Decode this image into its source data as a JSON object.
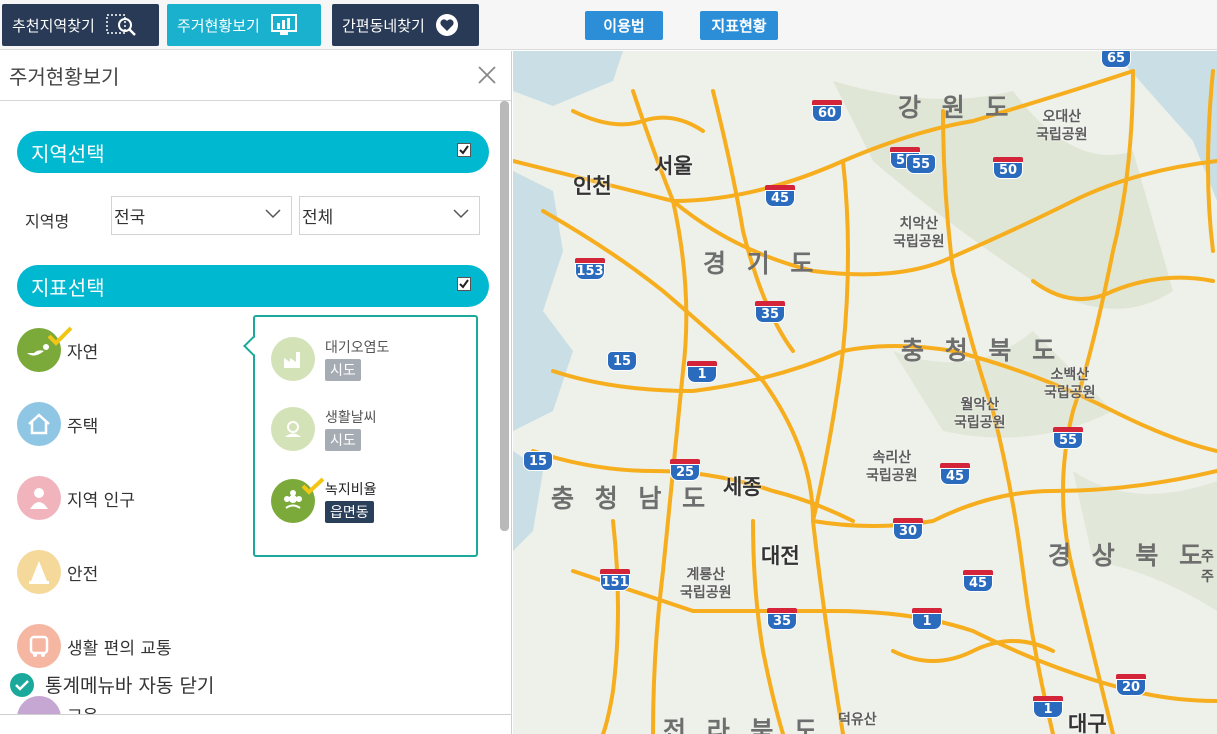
{
  "toolbar": {
    "recommend_label": "추천지역찾기",
    "housing_label": "주거현황보기",
    "easy_label": "간편동네찾기",
    "help_label": "이용법",
    "indicator_label": "지표현황"
  },
  "panel": {
    "title": "주거현황보기",
    "region_section": "지역선택",
    "region_name_label": "지역명",
    "region_select_1": "전국",
    "region_select_2": "전체",
    "indicator_section": "지표선택",
    "indicators": [
      {
        "label": "자연",
        "color": "#7ba93a"
      },
      {
        "label": "주택",
        "color": "#8fc6e4"
      },
      {
        "label": "지역 인구",
        "color": "#f1b4bd"
      },
      {
        "label": "안전",
        "color": "#f4d99a"
      },
      {
        "label": "생활 편의 교통",
        "color": "#f5b7a2"
      },
      {
        "label": "교육",
        "color": "#c6a6d3"
      }
    ],
    "sub_indicators": [
      {
        "label": "대기오염도",
        "tag": "시도"
      },
      {
        "label": "생활날씨",
        "tag": "시도"
      },
      {
        "label": "녹지비율",
        "tag": "읍면동"
      }
    ],
    "auto_close": "통계메뉴바 자동 닫기"
  },
  "map": {
    "provinces": [
      "강 원 도",
      "경 기 도",
      "충 청 북 도",
      "충 청 남 도",
      "경 상 북 도",
      "전 라 북 도"
    ],
    "cities": [
      "서울",
      "인천",
      "세종",
      "대전",
      "대구"
    ],
    "parks": [
      "오대산\n국립공원",
      "치악산\n국립공원",
      "소백산\n국립공원",
      "월악산\n국립공원",
      "속리산\n국립공원",
      "계룡산\n국립공원",
      "덕유산"
    ],
    "shields": [
      "65",
      "60",
      "55",
      "50",
      "45",
      "153",
      "35",
      "15",
      "1",
      "55",
      "25",
      "45",
      "30",
      "151",
      "35",
      "1",
      "45",
      "20",
      "1",
      "55",
      "15"
    ],
    "edge_labels": [
      "주",
      "주"
    ],
    "colors": {
      "road": "#f6ae1e",
      "accent": "#00b8d0",
      "nav_dark": "#283a55"
    }
  }
}
